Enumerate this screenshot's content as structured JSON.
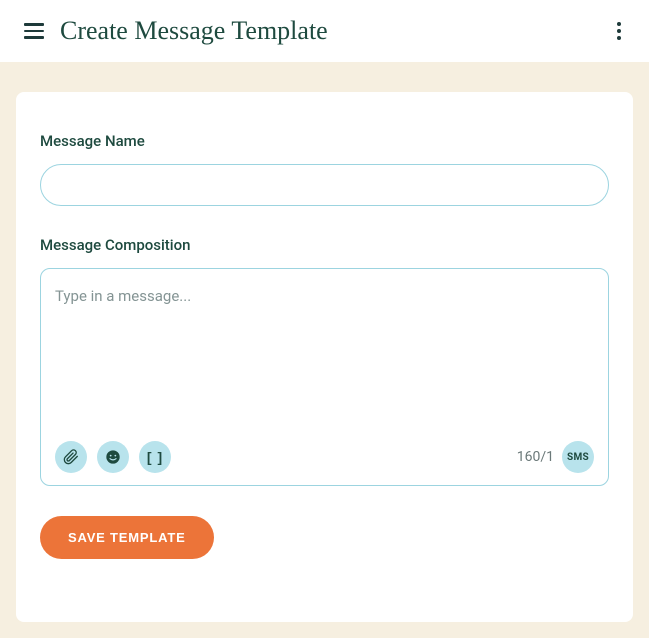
{
  "header": {
    "title": "Create Message Template"
  },
  "form": {
    "messageName": {
      "label": "Message Name",
      "value": ""
    },
    "composition": {
      "label": "Message Composition",
      "placeholder": "Type in a message...",
      "value": "",
      "charCount": "160/1",
      "smsBadge": "SMS"
    },
    "saveButton": "SAVE TEMPLATE"
  },
  "icons": {
    "attachment": "paperclip-icon",
    "emoji": "emoji-icon",
    "placeholder": "brackets-icon"
  },
  "colors": {
    "accent": "#ec7439",
    "primary": "#1e4a3f",
    "border": "#9cd4e0",
    "toolBg": "#b8e3ec",
    "pageBg": "#f6efe0"
  }
}
